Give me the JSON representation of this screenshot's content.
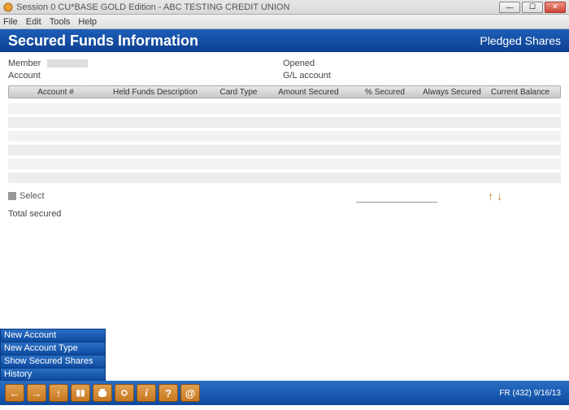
{
  "window": {
    "title": "Session 0 CU*BASE GOLD Edition - ABC TESTING CREDIT UNION"
  },
  "menu": {
    "file": "File",
    "edit": "Edit",
    "tools": "Tools",
    "help": "Help"
  },
  "header": {
    "title": "Secured Funds Information",
    "subtitle": "Pledged Shares"
  },
  "info": {
    "member_label": "Member",
    "account_label": "Account",
    "opened_label": "Opened",
    "glaccount_label": "G/L account"
  },
  "grid": {
    "cols": {
      "account": "Account #",
      "desc": "Held Funds Description",
      "cardtype": "Card Type",
      "amount": "Amount Secured",
      "pct": "% Secured",
      "always": "Always Secured",
      "balance": "Current Balance"
    }
  },
  "select": {
    "label": "Select"
  },
  "total": {
    "label": "Total secured"
  },
  "leftbuttons": {
    "newacct": "New Account",
    "newtype": "New Account Type",
    "showsec": "Show Secured Shares",
    "history": "History"
  },
  "footer": {
    "text": "FR (432) 9/16/13"
  },
  "toolbar_icons": {
    "back": "←",
    "forward": "→",
    "up": "↑",
    "pause": "▮▮",
    "print": "⎙",
    "link": "🔗",
    "info": "i",
    "help": "?",
    "at": "@"
  }
}
